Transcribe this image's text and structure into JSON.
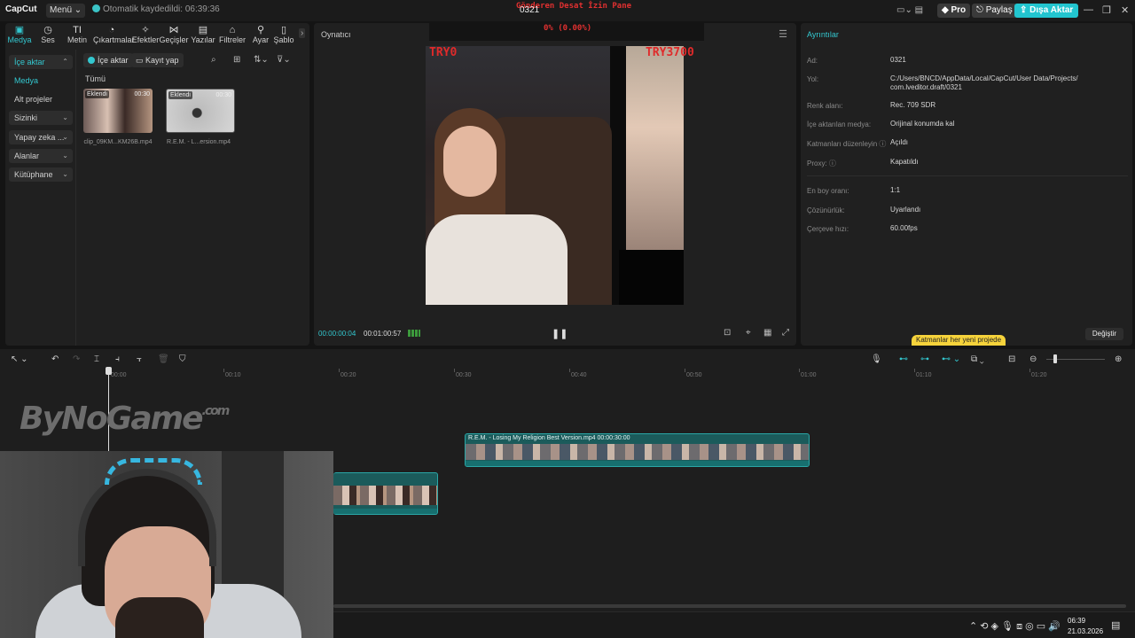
{
  "titlebar": {
    "app_name": "CapCut",
    "menu_label": "Menü ⌄",
    "autosave_text": "Otomatik kaydedildi: 06:39:36",
    "project_title": "0321",
    "stream_overlay": "Gönderen Desat İzin Pane",
    "stream_percent": "0% (0.00%)",
    "pro_label": "Pro",
    "share_label": "Paylaş",
    "export_label": "Dışa Aktar",
    "minimize": "—",
    "maximize": "❐",
    "close": "✕"
  },
  "toolbar": {
    "items": [
      {
        "label": "Medya",
        "icon": "▣"
      },
      {
        "label": "Ses",
        "icon": "◷"
      },
      {
        "label": "Metin",
        "icon": "TI"
      },
      {
        "label": "Çıkartmalar",
        "icon": "◔"
      },
      {
        "label": "Efektler",
        "icon": "✧"
      },
      {
        "label": "Geçişler",
        "icon": "⋈"
      },
      {
        "label": "Yazılar",
        "icon": "▤"
      },
      {
        "label": "Filtreler",
        "icon": "⌂"
      },
      {
        "label": "Ayar",
        "icon": "⚲"
      },
      {
        "label": "Şablo",
        "icon": "▯"
      }
    ],
    "more": "›"
  },
  "sidebar": {
    "items": [
      {
        "label": "İçe aktar",
        "chevron": "⌃"
      },
      {
        "label": "Medya",
        "chevron": ""
      },
      {
        "label": "Alt projeler",
        "chevron": ""
      },
      {
        "label": "Sizinki",
        "chevron": "⌄"
      },
      {
        "label": "Yapay zeka ...",
        "chevron": "⌄"
      },
      {
        "label": "Alanlar",
        "chevron": "⌄"
      },
      {
        "label": "Kütüphane",
        "chevron": "⌄"
      }
    ]
  },
  "media": {
    "import_label": "İçe aktar",
    "record_label": "Kayıt yap",
    "all_label": "Tümü",
    "search_icon": "⌕",
    "grid_icon": "⊞",
    "sort_icon": "⇅⌄",
    "filter_icon": "⊽⌄",
    "items": [
      {
        "badge": "Eklendi",
        "duration": "00:30",
        "name": "clip_09KM...KM26B.mp4"
      },
      {
        "badge": "Eklendi",
        "duration": "00:30",
        "name": "R.E.M. - L...ersion.mp4"
      }
    ]
  },
  "player": {
    "title": "Oynatıcı",
    "menu_icon": "☰",
    "current_time": "00:00:00:04",
    "total_time": "00:01:00:57",
    "pause_icon": "❚❚",
    "overlay_left": "TRY0",
    "overlay_right": "TRY3700",
    "icons": [
      "⊡",
      "⌖",
      "▦",
      "⤢"
    ]
  },
  "details": {
    "title": "Ayrıntılar",
    "rows": [
      {
        "label": "Ad:",
        "value": "0321"
      },
      {
        "label": "Yol:",
        "value": "C:/Users/BNCD/AppData/Local/CapCut/User Data/Projects/ com.lveditor.draft/0321"
      },
      {
        "label": "Renk alanı:",
        "value": "Rec. 709 SDR"
      },
      {
        "label": "İçe aktarılan medya:",
        "value": "Orijinal konumda kal"
      },
      {
        "label": "Katmanları düzenleyin ⓘ",
        "value": "Açıldı"
      },
      {
        "label": "Proxy: ⓘ",
        "value": "Kapatıldı"
      },
      {
        "label": "En boy oranı:",
        "value": "1:1"
      },
      {
        "label": "Çözünürlük:",
        "value": "Uyarlandı"
      },
      {
        "label": "Çerçeve hızı:",
        "value": "60.00fps"
      }
    ],
    "tip": "Katmanlar her yeni projede",
    "change_label": "Değiştir"
  },
  "timeline": {
    "tools_left": [
      "↖ ⌄",
      "↶",
      "↷",
      "⌶",
      "⫞",
      "⫟",
      "🗑",
      "⛉"
    ],
    "tools_right": [
      "🎙",
      "⊷",
      "⊶",
      "⊷ ⌄",
      "⧉ ⌄",
      "⊟",
      "⊖",
      "⊕"
    ],
    "ruler": [
      "00:00",
      "00:10",
      "00:20",
      "00:30",
      "00:40",
      "00:50",
      "01:00",
      "01:10",
      "01:20"
    ],
    "clip_main_label": "R.E.M. - Losing My Religion Best Version.mp4   00:00:30:00",
    "clip_small_label": ""
  },
  "watermark": {
    "text": "ByNoGame",
    "suffix": ".com"
  },
  "taskbar": {
    "tray_icons": "⌃  ⟲  ◈  🎙  ⧈  ◎  ▭  🔊",
    "time": "06:39",
    "date": "21.03.2026",
    "notification_icon": "▤"
  }
}
